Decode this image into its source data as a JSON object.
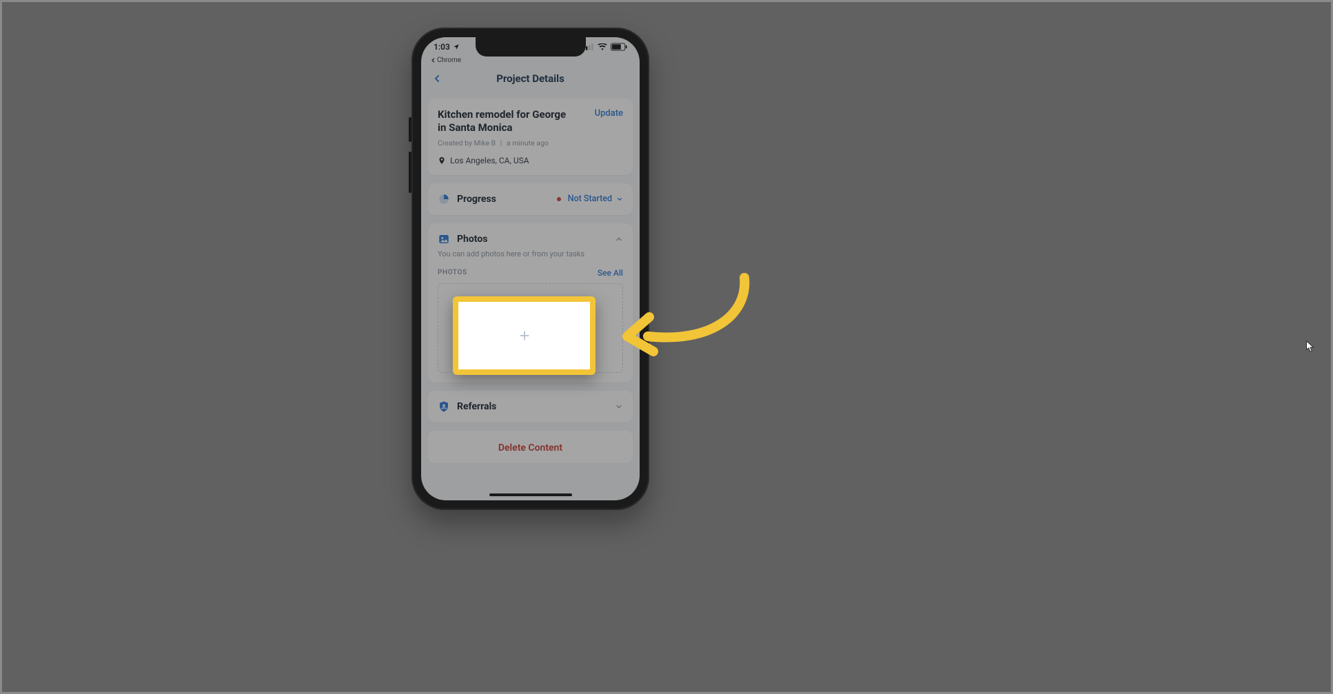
{
  "statusbar": {
    "time": "1:03",
    "back_app": "Chrome"
  },
  "nav": {
    "title": "Project Details"
  },
  "project": {
    "title": "Kitchen remodel for George in Santa Monica",
    "update_label": "Update",
    "created_by_prefix": "Created by",
    "created_by": "Mike B",
    "created_sep": "|",
    "created_ago": "a minute ago",
    "location": "Los Angeles, CA, USA"
  },
  "progress": {
    "label": "Progress",
    "status": "Not Started"
  },
  "photos": {
    "label": "Photos",
    "description": "You can add photos here or from your tasks",
    "subhead": "PHOTOS",
    "see_all": "See All"
  },
  "referrals": {
    "label": "Referrals"
  },
  "delete": {
    "label": "Delete Content"
  },
  "annotation": {
    "highlight_icon": "plus-icon",
    "arrow_color": "#f2c437"
  }
}
